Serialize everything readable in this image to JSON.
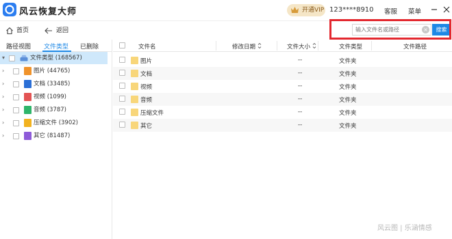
{
  "app": {
    "title": "风云恢复大师",
    "vip_label": "开通VIP",
    "account": "123****8910",
    "service_label": "客服",
    "menu_label": "菜单",
    "accent": "#1e88e5",
    "highlight": "#e3282f"
  },
  "toolbar": {
    "home_label": "首页",
    "back_label": "返回",
    "search_placeholder": "输入文件名或路径",
    "search_button": "搜索"
  },
  "left_tabs": [
    {
      "label": "路径视图",
      "active": false
    },
    {
      "label": "文件类型",
      "active": true
    },
    {
      "label": "已删除",
      "active": false
    }
  ],
  "tree": {
    "root": {
      "label": "文件类型 (168567)",
      "icon": "drive-icon"
    },
    "items": [
      {
        "label": "图片 (44765)",
        "icon": "image-file-icon",
        "color": "#f0932b"
      },
      {
        "label": "文档 (33485)",
        "icon": "document-file-icon",
        "color": "#2b6fd6"
      },
      {
        "label": "视频 (1099)",
        "icon": "video-file-icon",
        "color": "#e35454"
      },
      {
        "label": "音频 (3787)",
        "icon": "audio-file-icon",
        "color": "#2fb56a"
      },
      {
        "label": "压缩文件 (3902)",
        "icon": "archive-file-icon",
        "color": "#f2b21f"
      },
      {
        "label": "其它 (81487)",
        "icon": "other-file-icon",
        "color": "#8e5bd9"
      }
    ]
  },
  "table": {
    "columns": [
      "文件名",
      "修改日期",
      "文件大小",
      "文件类型",
      "文件路径"
    ],
    "rows": [
      {
        "name": "图片",
        "date": "",
        "size": "--",
        "type": "文件夹",
        "path": ""
      },
      {
        "name": "文档",
        "date": "",
        "size": "--",
        "type": "文件夹",
        "path": ""
      },
      {
        "name": "视频",
        "date": "",
        "size": "--",
        "type": "文件夹",
        "path": ""
      },
      {
        "name": "音频",
        "date": "",
        "size": "--",
        "type": "文件夹",
        "path": ""
      },
      {
        "name": "压缩文件",
        "date": "",
        "size": "--",
        "type": "文件夹",
        "path": ""
      },
      {
        "name": "其它",
        "date": "",
        "size": "--",
        "type": "文件夹",
        "path": ""
      }
    ]
  },
  "watermark": "风云图 | 乐涵情感"
}
